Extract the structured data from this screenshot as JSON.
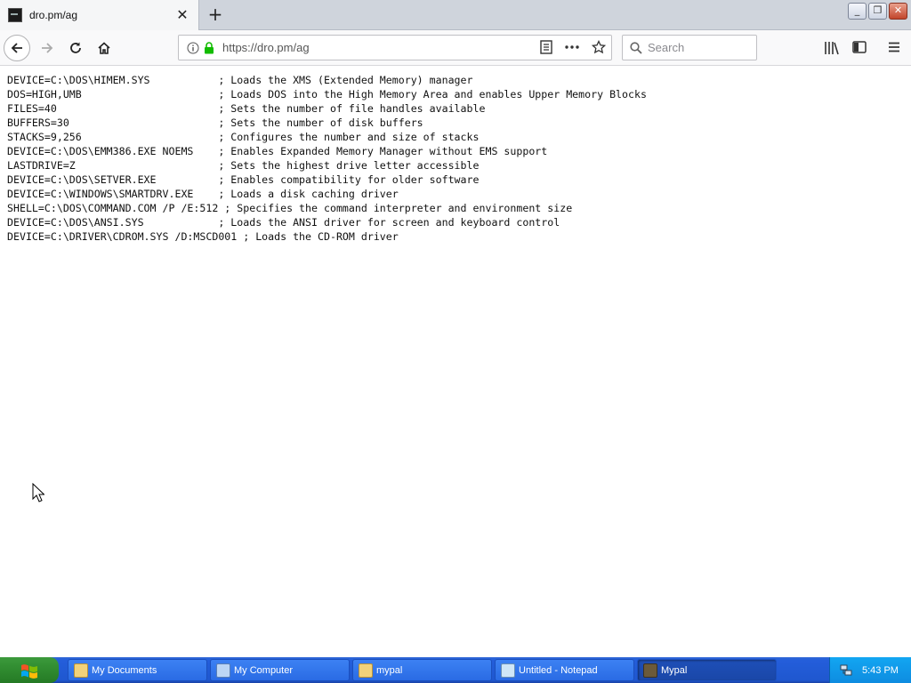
{
  "browser": {
    "tab_title": "dro.pm/ag",
    "url": "https://dro.pm/ag",
    "search_placeholder": "Search",
    "window_buttons": [
      "_",
      "❐",
      "✕"
    ]
  },
  "content": {
    "lines": [
      "DEVICE=C:\\DOS\\HIMEM.SYS           ; Loads the XMS (Extended Memory) manager",
      "DOS=HIGH,UMB                      ; Loads DOS into the High Memory Area and enables Upper Memory Blocks",
      "FILES=40                          ; Sets the number of file handles available",
      "BUFFERS=30                        ; Sets the number of disk buffers",
      "STACKS=9,256                      ; Configures the number and size of stacks",
      "DEVICE=C:\\DOS\\EMM386.EXE NOEMS    ; Enables Expanded Memory Manager without EMS support",
      "LASTDRIVE=Z                       ; Sets the highest drive letter accessible",
      "DEVICE=C:\\DOS\\SETVER.EXE          ; Enables compatibility for older software",
      "DEVICE=C:\\WINDOWS\\SMARTDRV.EXE    ; Loads a disk caching driver",
      "SHELL=C:\\DOS\\COMMAND.COM /P /E:512 ; Specifies the command interpreter and environment size",
      "DEVICE=C:\\DOS\\ANSI.SYS            ; Loads the ANSI driver for screen and keyboard control",
      "DEVICE=C:\\DRIVER\\CDROM.SYS /D:MSCD001 ; Loads the CD-ROM driver"
    ]
  },
  "taskbar": {
    "tasks": [
      {
        "label": "My Documents",
        "icon": "folder-documents-icon",
        "color": "#f2d27a"
      },
      {
        "label": "My Computer",
        "icon": "computer-icon",
        "color": "#bcd6f5"
      },
      {
        "label": "mypal",
        "icon": "folder-icon",
        "color": "#f2d27a"
      },
      {
        "label": "Untitled - Notepad",
        "icon": "notepad-icon",
        "color": "#cfe6f7"
      },
      {
        "label": "Mypal",
        "icon": "mypal-browser-icon",
        "color": "#6b5a3a",
        "active": true
      }
    ],
    "clock": "5:43 PM"
  }
}
